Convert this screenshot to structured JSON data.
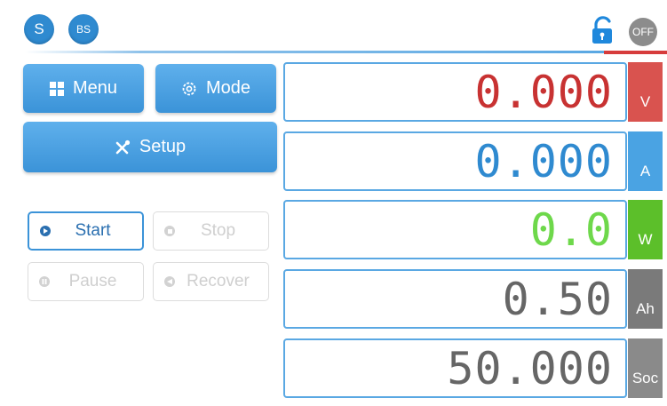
{
  "header": {
    "badge_s": "S",
    "badge_bs": "BS",
    "lock_icon": "unlock-icon",
    "off_label": "OFF"
  },
  "nav": {
    "menu_label": "Menu",
    "menu_icon": "grid-icon",
    "mode_label": "Mode",
    "mode_icon": "gear-icon",
    "setup_label": "Setup",
    "setup_icon": "wrench-icon"
  },
  "controls": {
    "start_label": "Start",
    "stop_label": "Stop",
    "pause_label": "Pause",
    "recover_label": "Recover",
    "active": "start"
  },
  "readings": [
    {
      "value": "0.000",
      "unit": "V",
      "color": "#c83232",
      "unit_bg": "#d9534f"
    },
    {
      "value": "0.000",
      "unit": "A",
      "color": "#2f8ad0",
      "unit_bg": "#4aa3e3"
    },
    {
      "value": "0.0",
      "unit": "W",
      "color": "#6ed84b",
      "unit_bg": "#5cbf2a"
    },
    {
      "value": "0.50",
      "unit": "Ah",
      "color": "#666666",
      "unit_bg": "#7a7a7a"
    },
    {
      "value": "50.000",
      "unit": "Soc",
      "color": "#666666",
      "unit_bg": "#8a8a8a"
    }
  ]
}
